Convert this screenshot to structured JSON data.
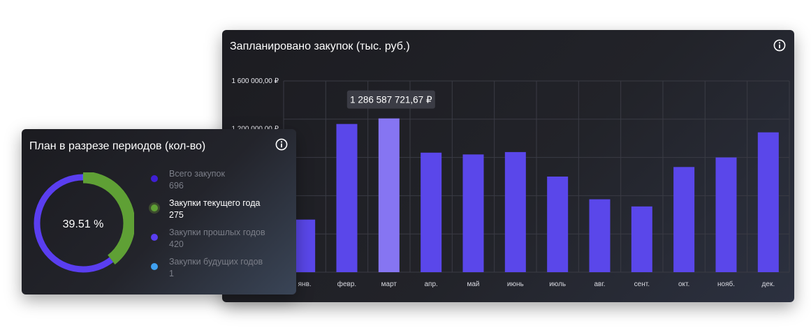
{
  "bar_card": {
    "title": "Запланировано закупок (тыс. руб.)",
    "tooltip": "1 286 587 721,67 ₽",
    "info_icon": "info-icon"
  },
  "donut_card": {
    "title": "План в разрезе периодов (кол-во)",
    "center_label": "39.51 %",
    "info_icon": "info-icon",
    "legend": [
      {
        "label": "Всего закупок",
        "value": "696",
        "color": "#3f1fd4",
        "active": false
      },
      {
        "label": "Закупки текущего года",
        "value": "275",
        "color": "#5fa035",
        "active": true
      },
      {
        "label": "Закупки прошлых годов",
        "value": "420",
        "color": "#5a3ef0",
        "active": false
      },
      {
        "label": "Закупки будущих годов",
        "value": "1",
        "color": "#3fa0f0",
        "active": false
      }
    ]
  },
  "chart_data": [
    {
      "type": "bar",
      "title": "Запланировано закупок (тыс. руб.)",
      "categories": [
        "янв.",
        "февр.",
        "март",
        "апр.",
        "май",
        "июнь",
        "июль",
        "авг.",
        "сент.",
        "окт.",
        "нояб.",
        "дек."
      ],
      "values": [
        440000,
        1240000,
        1286587.72,
        1000000,
        985000,
        1005000,
        800000,
        610000,
        550000,
        880000,
        960000,
        1170000
      ],
      "y_tick_labels": [
        {
          "value": 1600000,
          "label": "1 600 000,00 ₽"
        },
        {
          "value": 1200000,
          "label": "1 200 000,00 ₽"
        }
      ],
      "ylim": [
        0,
        1600000
      ],
      "highlighted_index": 2,
      "grid": true,
      "colors": {
        "bar": "#5a47ea",
        "highlight": "#8675f2",
        "grid": "#3a3b44"
      }
    },
    {
      "type": "pie",
      "title": "План в разрезе периодов (кол-во)",
      "center_label": "39.51 %",
      "segments": [
        {
          "name": "Закупки текущего года",
          "value": 275,
          "color": "#5fa035"
        },
        {
          "name": "Закупки прошлых годов",
          "value": 420,
          "color": "#5a3ef0"
        },
        {
          "name": "Закупки будущих годов",
          "value": 1,
          "color": "#3fa0f0"
        }
      ],
      "total": 696
    }
  ]
}
